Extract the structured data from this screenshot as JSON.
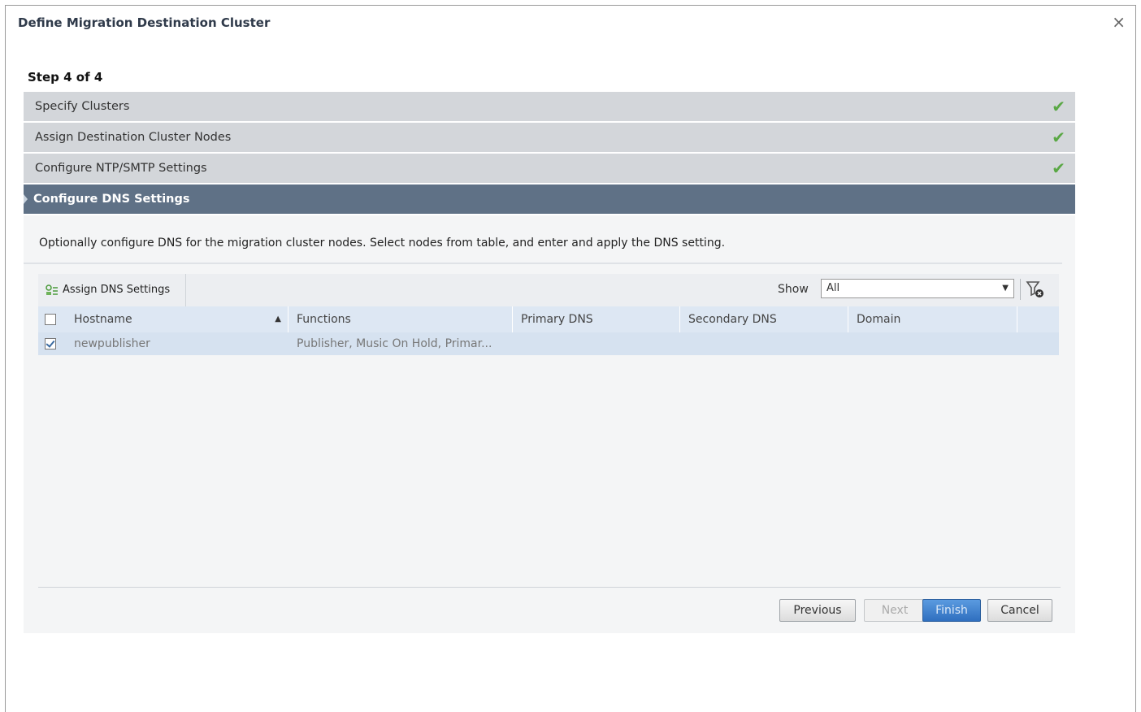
{
  "dialog": {
    "title": "Define Migration Destination Cluster",
    "close_label": "×",
    "step_text": "Step 4 of 4"
  },
  "wizard": {
    "steps": [
      {
        "label": "Specify Clusters",
        "status": "complete"
      },
      {
        "label": "Assign Destination Cluster Nodes",
        "status": "complete"
      },
      {
        "label": "Configure NTP/SMTP Settings",
        "status": "complete"
      },
      {
        "label": "Configure DNS Settings",
        "status": "active"
      }
    ],
    "check_glyph": "✔"
  },
  "content": {
    "description": "Optionally configure DNS for the migration cluster nodes. Select nodes from table, and enter and apply the DNS setting.",
    "toolbar": {
      "assign_label": "Assign DNS Settings",
      "show_label": "Show",
      "show_value": "All"
    },
    "table": {
      "columns": [
        "Hostname",
        "Functions",
        "Primary DNS",
        "Secondary DNS",
        "Domain"
      ],
      "sort_column": "Hostname",
      "sort_direction": "ascending",
      "rows": [
        {
          "checked": true,
          "hostname": "newpublisher",
          "functions": "Publisher, Music On Hold, Primar...",
          "primary_dns": "",
          "secondary_dns": "",
          "domain": ""
        }
      ]
    }
  },
  "buttons": {
    "previous": "Previous",
    "next": "Next",
    "finish": "Finish",
    "cancel": "Cancel"
  },
  "colors": {
    "active_step_bg": "#5f7186",
    "step_bg": "#d3d6da",
    "check": "#5aa845",
    "header_bg": "#dde7f3",
    "primary_btn": "#2f6fbf"
  }
}
